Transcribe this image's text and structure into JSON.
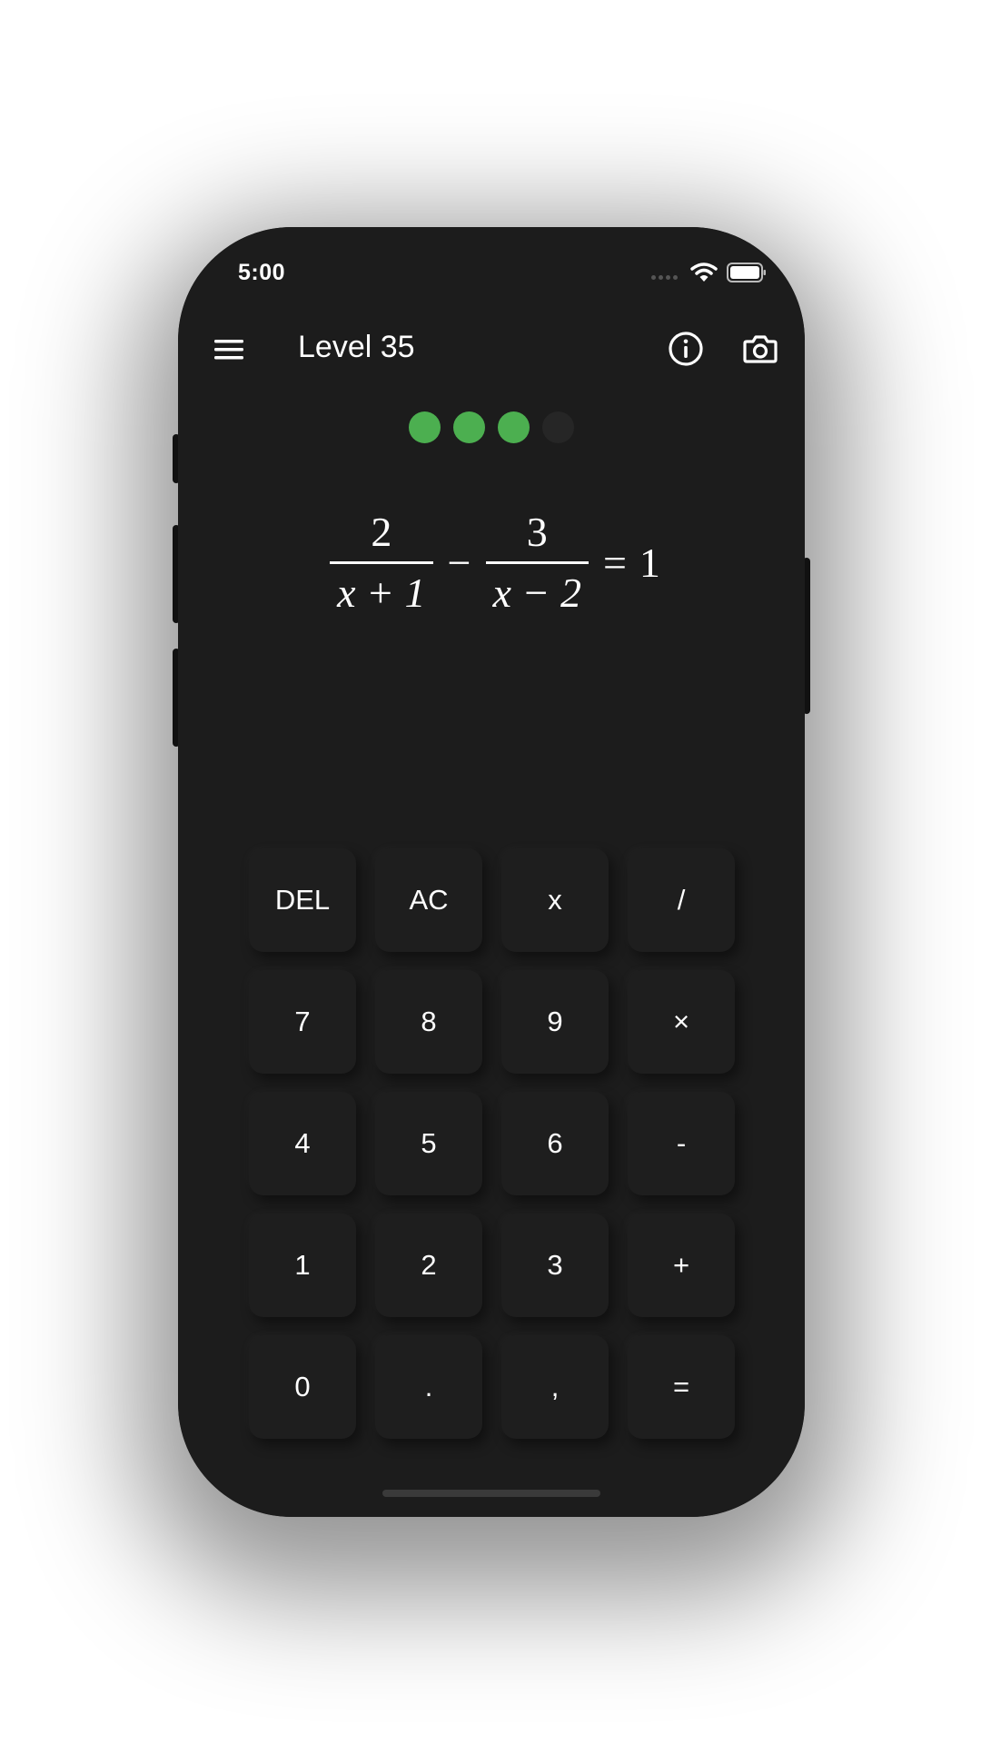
{
  "status_bar": {
    "time": "5:00",
    "signal_icon": "signal-dots-icon",
    "wifi_icon": "wifi-icon",
    "battery_icon": "battery-icon"
  },
  "header": {
    "menu_icon": "menu-icon",
    "title": "Level 35",
    "info_icon": "info-icon",
    "camera_icon": "camera-icon"
  },
  "progress": {
    "completed": 3,
    "total": 4,
    "done_color": "#4caf50",
    "pending_color": "#262626"
  },
  "equation": {
    "frac1_num": "2",
    "frac1_den": "x + 1",
    "operator": "−",
    "frac2_num": "3",
    "frac2_den": "x − 2",
    "equals": "=",
    "rhs": "1"
  },
  "keypad": {
    "keys": [
      "DEL",
      "AC",
      "x",
      "/",
      "7",
      "8",
      "9",
      "×",
      "4",
      "5",
      "6",
      "-",
      "1",
      "2",
      "3",
      "+",
      "0",
      ".",
      ",",
      "="
    ]
  }
}
